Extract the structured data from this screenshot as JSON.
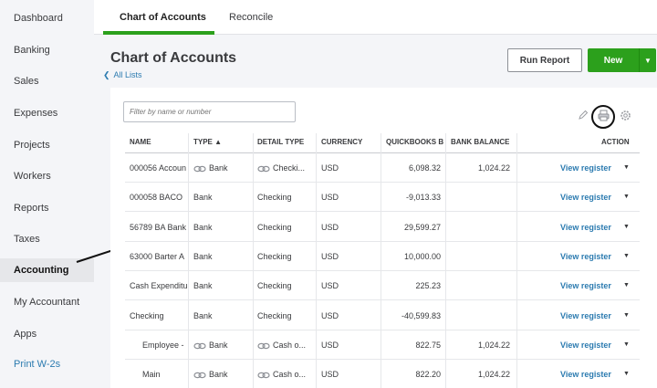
{
  "sidebar": {
    "items": [
      {
        "label": "Dashboard"
      },
      {
        "label": "Banking"
      },
      {
        "label": "Sales"
      },
      {
        "label": "Expenses"
      },
      {
        "label": "Projects"
      },
      {
        "label": "Workers"
      },
      {
        "label": "Reports"
      },
      {
        "label": "Taxes"
      },
      {
        "label": "Accounting"
      },
      {
        "label": "My Accountant"
      },
      {
        "label": "Apps"
      },
      {
        "label": "Print W-2s"
      }
    ],
    "active": "Accounting"
  },
  "tabs": [
    {
      "label": "Chart of Accounts"
    },
    {
      "label": "Reconcile"
    }
  ],
  "header": {
    "title": "Chart of Accounts",
    "back_link": "All Lists",
    "run_report": "Run Report",
    "new": "New"
  },
  "search": {
    "placeholder": "Filter by name or number"
  },
  "table": {
    "headers": {
      "name": "NAME",
      "type": "TYPE ▲",
      "detail_type": "DETAIL TYPE",
      "currency": "CURRENCY",
      "quickbooks": "QUICKBOOKS B",
      "bank_balance": "BANK BALANCE",
      "action": "ACTION"
    },
    "rows": [
      {
        "name": "000056 Accoun",
        "type": "Bank",
        "detail": "Checki...",
        "currency": "USD",
        "qb": "6,098.32",
        "bank": "1,024.22",
        "action": "View register"
      },
      {
        "name": "000058 BACO",
        "type": "Bank",
        "detail": "Checking",
        "currency": "USD",
        "qb": "-9,013.33",
        "bank": "",
        "action": "View register"
      },
      {
        "name": "56789 BA Bank",
        "type": "Bank",
        "detail": "Checking",
        "currency": "USD",
        "qb": "29,599.27",
        "bank": "",
        "action": "View register"
      },
      {
        "name": "63000 Barter A",
        "type": "Bank",
        "detail": "Checking",
        "currency": "USD",
        "qb": "10,000.00",
        "bank": "",
        "action": "View register"
      },
      {
        "name": "Cash Expenditu",
        "type": "Bank",
        "detail": "Checking",
        "currency": "USD",
        "qb": "225.23",
        "bank": "",
        "action": "View register"
      },
      {
        "name": "Checking",
        "type": "Bank",
        "detail": "Checking",
        "currency": "USD",
        "qb": "-40,599.83",
        "bank": "",
        "action": "View register"
      },
      {
        "name": "Employee -",
        "type": "Bank",
        "detail": "Cash o...",
        "currency": "USD",
        "qb": "822.75",
        "bank": "1,024.22",
        "action": "View register"
      },
      {
        "name": "Main",
        "type": "Bank",
        "detail": "Cash o...",
        "currency": "USD",
        "qb": "822.20",
        "bank": "1,024.22",
        "action": "View register"
      }
    ]
  },
  "colors": {
    "accent": "#2ca01c",
    "link": "#2c7bb0"
  },
  "icons": [
    "edit-icon",
    "print-icon",
    "settings-icon",
    "linked-bank-icon",
    "chevron-left-icon",
    "caret-down-icon"
  ]
}
